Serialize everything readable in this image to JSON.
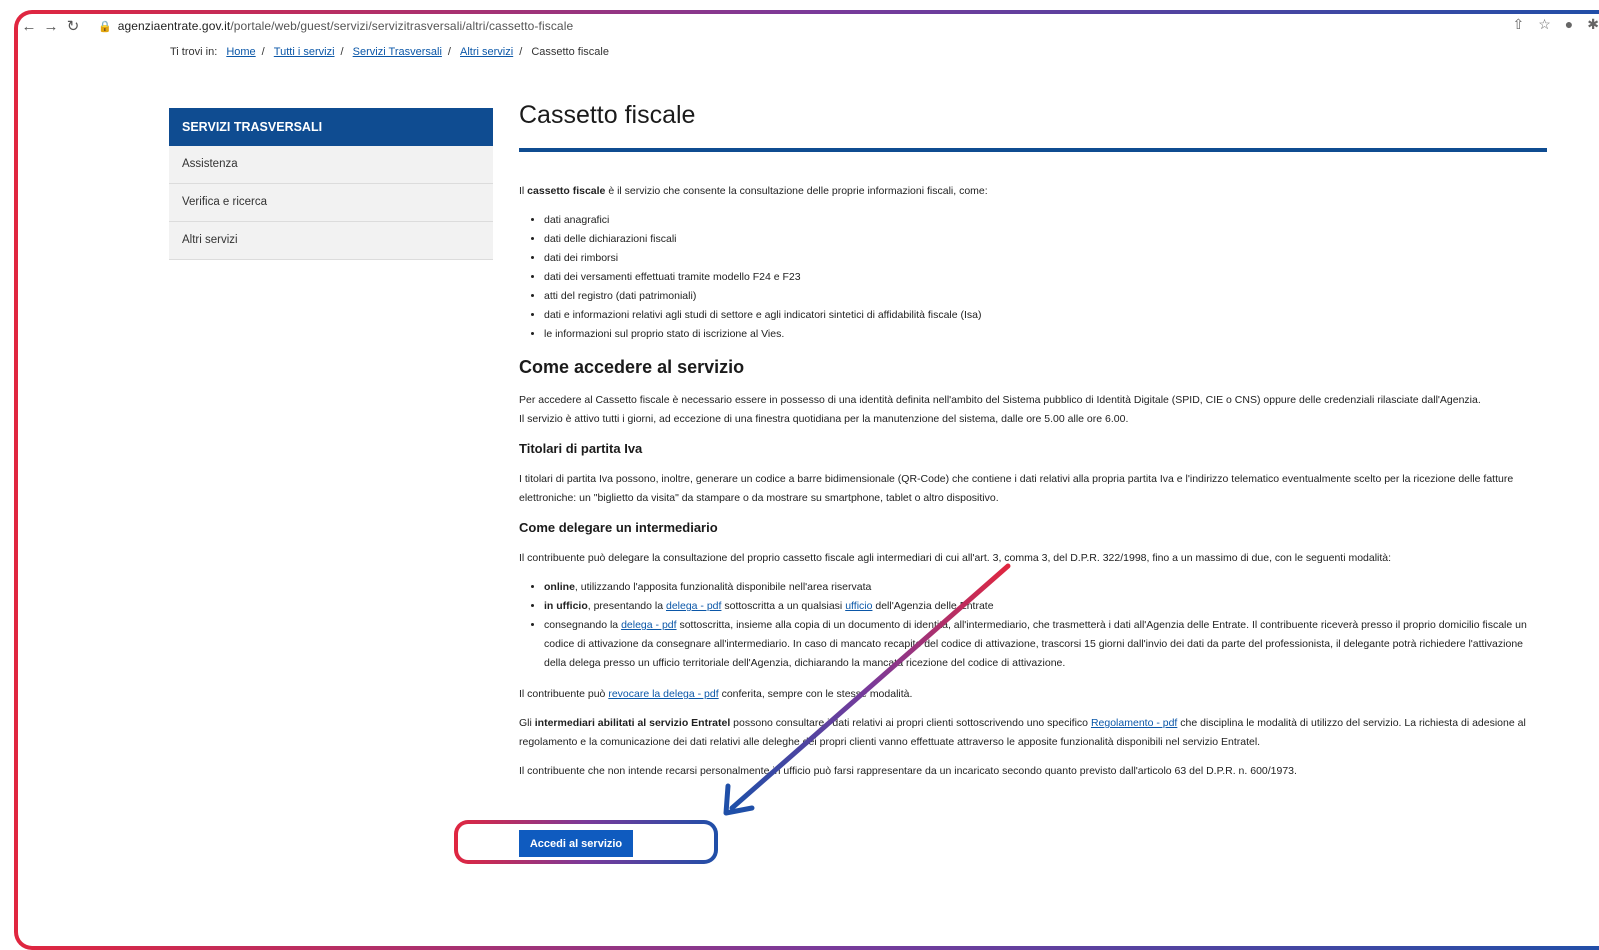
{
  "browser": {
    "url_domain": "agenziaentrate.gov.it",
    "url_path": "/portale/web/guest/servizi/servizitrasversali/altri/cassetto-fiscale"
  },
  "breadcrumb": {
    "prefix": "Ti trovi in:",
    "items": [
      "Home",
      "Tutti i servizi",
      "Servizi Trasversali",
      "Altri servizi"
    ],
    "current": "Cassetto fiscale"
  },
  "sidebar": {
    "title": "SERVIZI TRASVERSALI",
    "items": [
      "Assistenza",
      "Verifica e ricerca",
      "Altri servizi"
    ]
  },
  "main": {
    "title": "Cassetto fiscale",
    "intro_bold": "cassetto fiscale",
    "intro_pre": "Il",
    "intro_rest": "è il servizio che consente la consultazione delle proprie informazioni fiscali, come:",
    "list": [
      "dati anagrafici",
      "dati delle dichiarazioni fiscali",
      "dati dei rimborsi",
      "dati dei versamenti effettuati tramite modello F24 e F23",
      "atti del registro (dati patrimoniali)",
      "dati e informazioni relativi agli studi di settore e agli indicatori sintetici di affidabilità fiscale (Isa)",
      "le informazioni sul proprio stato di iscrizione al Vies."
    ],
    "access_heading": "Come accedere al servizio",
    "access_p1": "Per accedere al Cassetto fiscale è necessario essere in possesso di una identità definita nell'ambito del Sistema pubblico di Identità Digitale (SPID, CIE o CNS) oppure delle credenziali rilasciate dall'Agenzia.",
    "access_p2": "Il servizio è attivo tutti i giorni, ad eccezione di una finestra quotidiana per la manutenzione del sistema, dalle ore 5.00 alle ore 6.00.",
    "piva_heading": "Titolari di partita Iva",
    "piva_p": "I titolari di partita Iva possono, inoltre, generare un codice a barre bidimensionale (QR-Code) che contiene i dati relativi alla propria partita Iva e l'indirizzo telematico eventualmente scelto per la ricezione delle fatture elettroniche: un \"biglietto da visita\" da stampare o da mostrare su smartphone, tablet o altro dispositivo.",
    "delega_heading": "Come delegare un intermediario",
    "delega_p": "Il contribuente può delegare la consultazione del proprio cassetto fiscale agli intermediari di cui all'art. 3, comma 3, del D.P.R. 322/1998, fino a un massimo di due, con le seguenti modalità:",
    "delega_items": [
      {
        "bold": "online",
        "rest": ", utilizzando l'apposita funzionalità disponibile nell'area riservata"
      },
      {
        "bold": "in ufficio",
        "pre_link": ", presentando la",
        "link": "delega - pdf",
        "mid": "sottoscritta a un qualsiasi",
        "link2": "ufficio",
        "rest": "dell'Agenzia delle Entrate"
      },
      {
        "pre_link": "consegnando la",
        "link": "delega - pdf",
        "rest": "sottoscritta, insieme alla copia di un documento di identità, all'intermediario, che trasmetterà i dati all'Agenzia delle Entrate. Il contribuente riceverà presso il proprio domicilio fiscale un codice di attivazione da consegnare all'intermediario. In caso di mancato recapito del codice di attivazione, trascorsi 15 giorni dall'invio dei dati da parte del professionista, il delegante potrà richiedere l'attivazione della delega presso un ufficio territoriale dell'Agenzia, dichiarando la mancata ricezione del codice di attivazione."
      }
    ],
    "revoca_pre": "Il contribuente può",
    "revoca_link": "revocare la delega - pdf",
    "revoca_rest": "conferita, sempre con le stesse modalità.",
    "entratel_pre": "Gli",
    "entratel_bold": "intermediari abilitati al servizio Entratel",
    "entratel_mid": "possono consultare i dati relativi ai propri clienti sottoscrivendo uno specifico",
    "entratel_link": "Regolamento - pdf",
    "entratel_rest": "che disciplina le modalità di utilizzo del servizio. La richiesta di adesione al regolamento e la comunicazione dei dati relativi alle deleghe dei propri clienti vanno effettuate attraverso le apposite funzionalità disponibili nel servizio Entratel.",
    "incaricato_p": "Il contribuente che non intende recarsi personalmente in ufficio può farsi rappresentare da un incaricato secondo quanto previsto dall'articolo 63 del D.P.R. n. 600/1973.",
    "cta_label": "Accedi al servizio"
  },
  "colors": {
    "brand_blue": "#0f4c91",
    "button_blue": "#0f5bbf",
    "highlight_red": "#e0263f",
    "highlight_blue": "#1f4fa8"
  }
}
